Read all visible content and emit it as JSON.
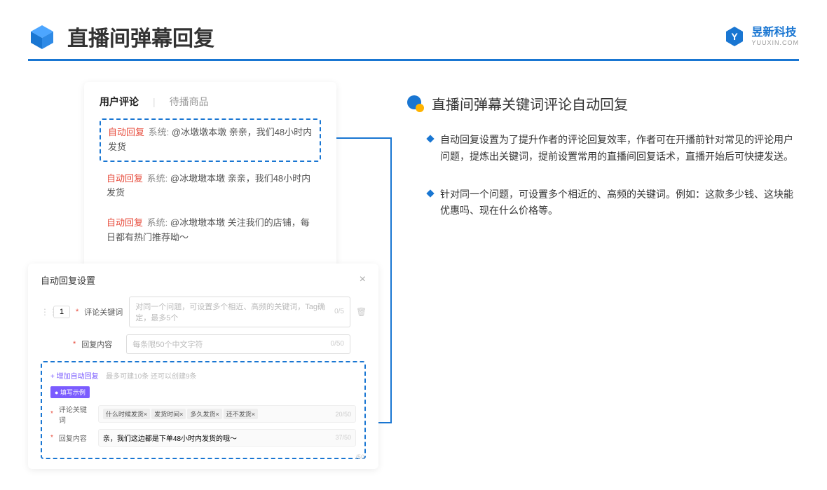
{
  "header": {
    "title": "直播间弹幕回复",
    "brand_name": "昱新科技",
    "brand_url": "YUUXIN.COM"
  },
  "comments_card": {
    "tab_active": "用户评论",
    "tab_inactive": "待播商品",
    "auto_tag": "自动回复",
    "sys_tag": "系统:",
    "c1": "@冰墩墩本墩 亲亲，我们48小时内发货",
    "c2": "@冰墩墩本墩 亲亲，我们48小时内发货",
    "c3": "@冰墩墩本墩 关注我们的店铺，每日都有热门推荐呦～"
  },
  "settings": {
    "title": "自动回复设置",
    "num": "1",
    "label_keyword": "评论关键词",
    "ph_keyword": "对同一个问题，可设置多个相近、高频的关键词，Tag确定，最多5个",
    "count_keyword": "0/5",
    "label_content": "回复内容",
    "ph_content": "每条限50个中文字符",
    "count_content": "0/50",
    "add_link": "+ 增加自动回复",
    "add_hint": "最多可建10条 还可以创建9条",
    "example_badge": "● 填写示例",
    "ex_label_kw": "评论关键词",
    "ex_kw_tags": [
      "什么时候发货×",
      "发货时间×",
      "多久发货×",
      "还不发货×"
    ],
    "ex_kw_count": "20/50",
    "ex_label_ct": "回复内容",
    "ex_content": "亲，我们这边都是下单48小时内发货的哦～",
    "ex_ct_count": "37/50",
    "outer_count": "/50"
  },
  "right": {
    "section_title": "直播间弹幕关键词评论自动回复",
    "bullet1": "自动回复设置为了提升作者的评论回复效率，作者可在开播前针对常见的评论用户问题，提炼出关键词，提前设置常用的直播间回复话术，直播开始后可快捷发送。",
    "bullet2": "针对同一个问题，可设置多个相近的、高频的关键词。例如：这款多少钱、这块能优惠吗、现在什么价格等。"
  }
}
